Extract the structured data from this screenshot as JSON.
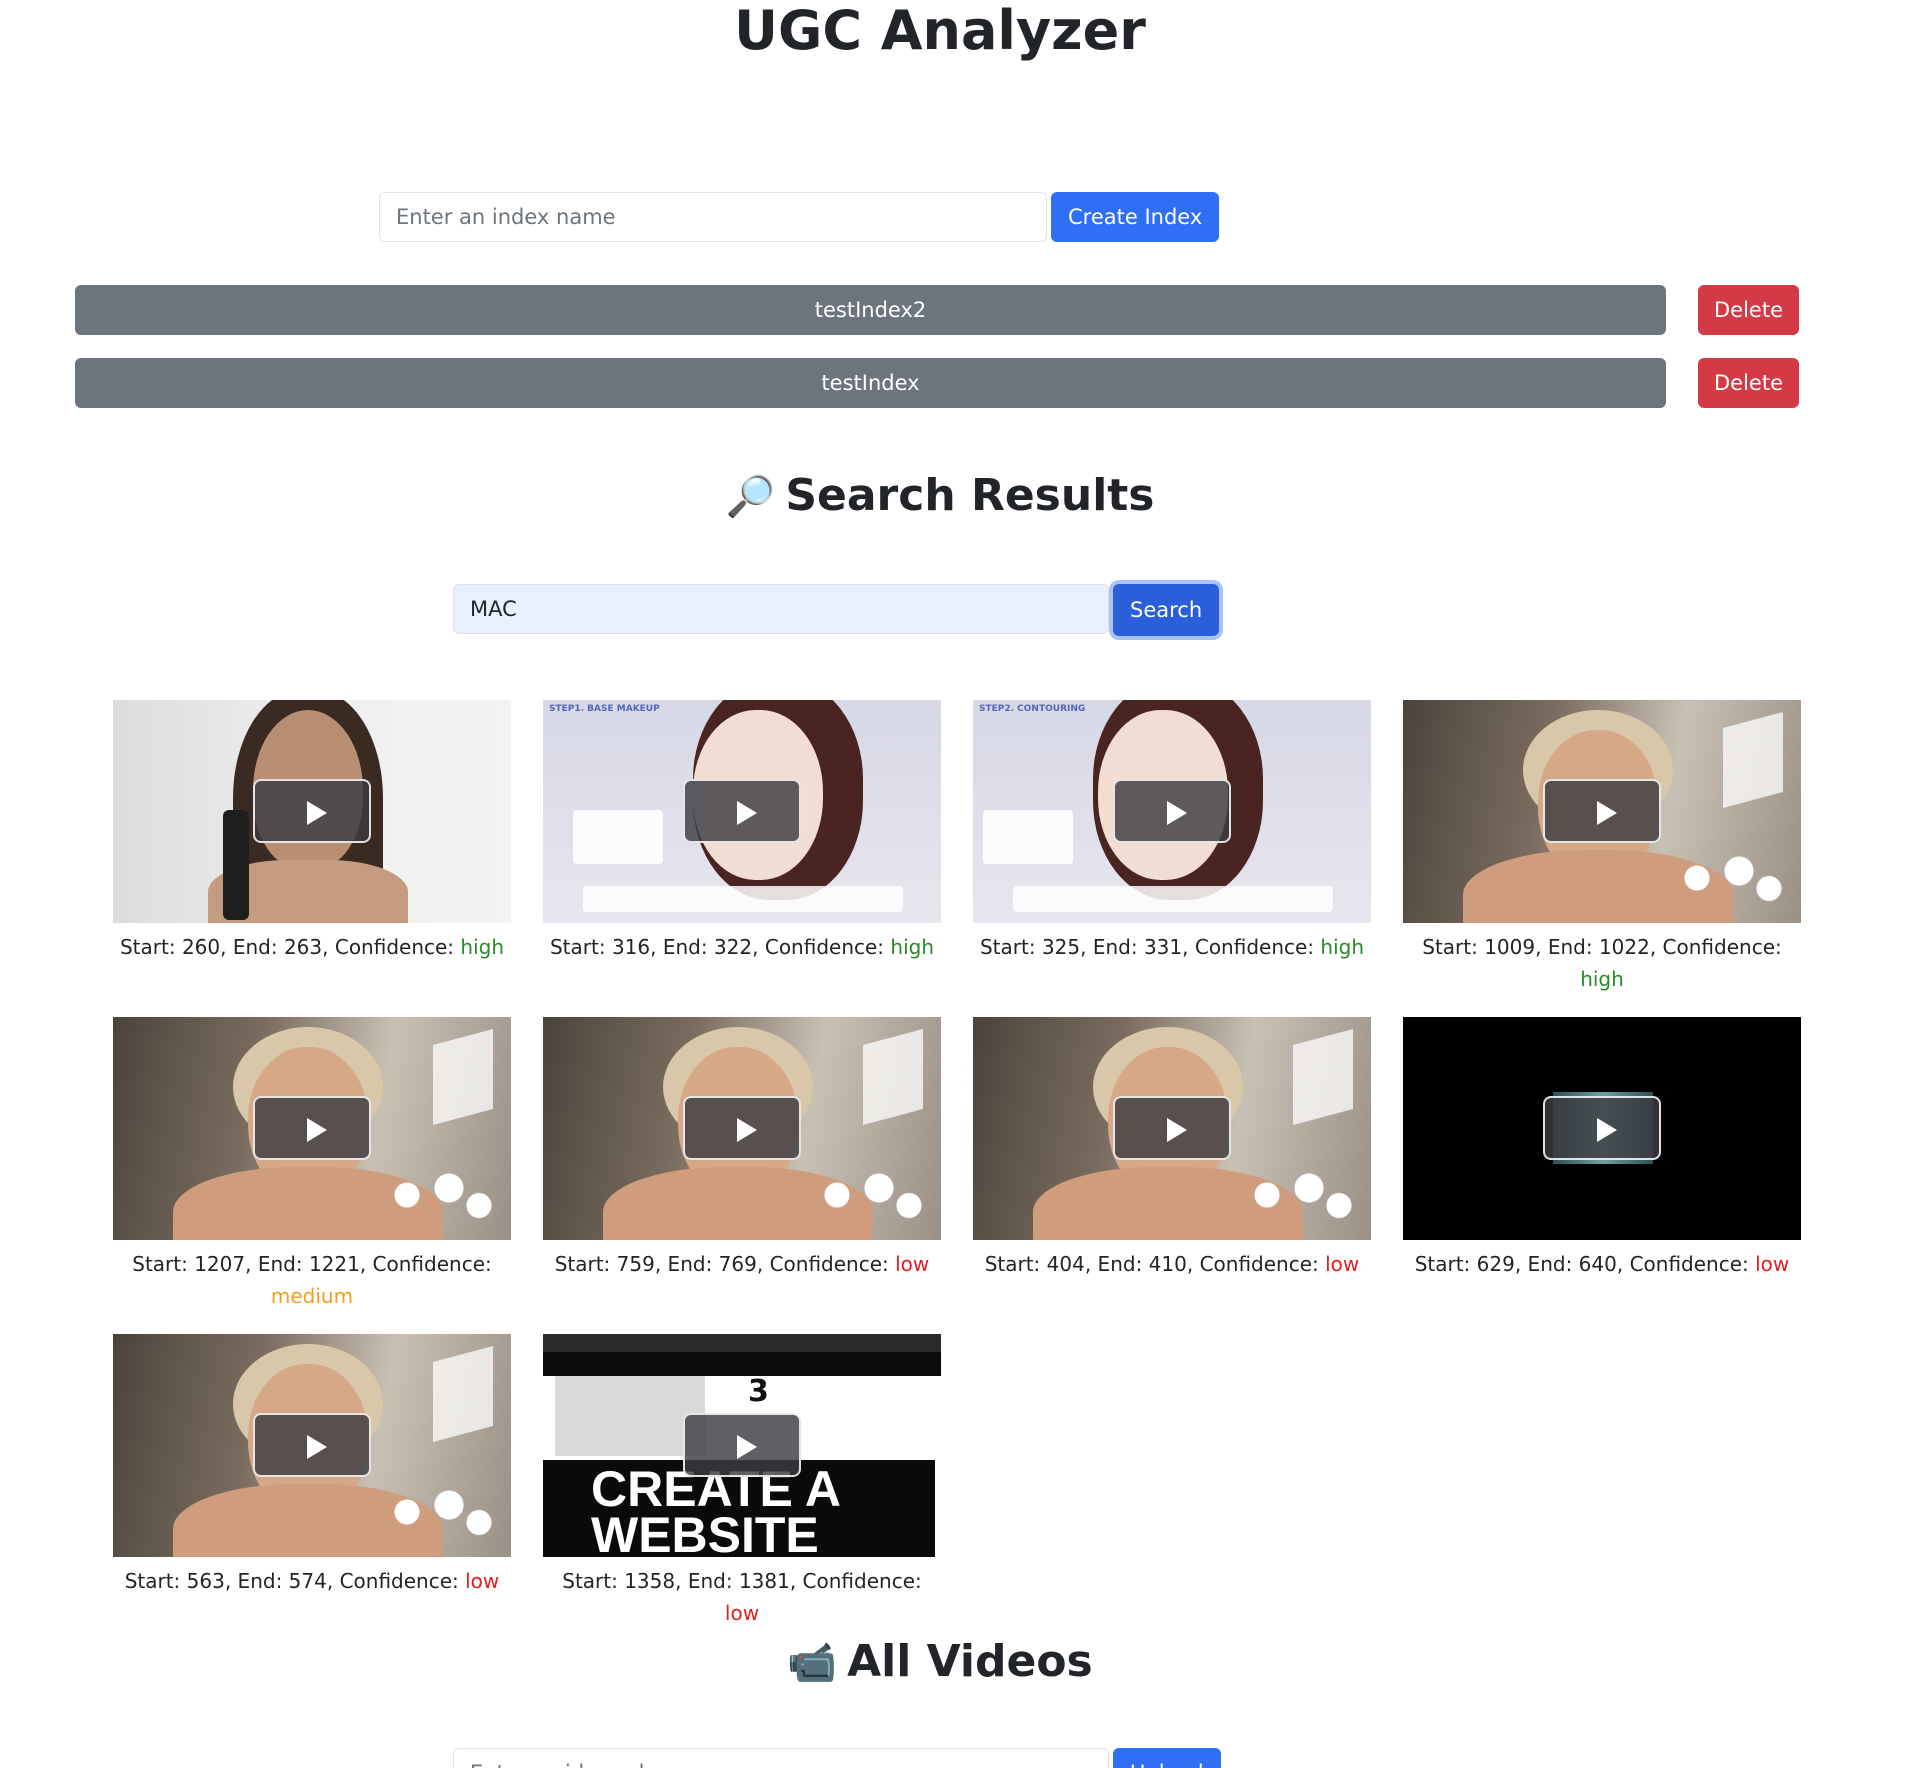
{
  "app": {
    "title": "UGC Analyzer"
  },
  "index_form": {
    "placeholder": "Enter an index name",
    "create_label": "Create Index"
  },
  "indexes": [
    {
      "name": "testIndex2",
      "delete_label": "Delete"
    },
    {
      "name": "testIndex",
      "delete_label": "Delete"
    }
  ],
  "search_section": {
    "icon": "🔎",
    "title": "Search Results",
    "query": "MAC",
    "search_label": "Search"
  },
  "results": [
    {
      "start": "260",
      "end": "263",
      "confidence": "high"
    },
    {
      "start": "316",
      "end": "322",
      "confidence": "high"
    },
    {
      "start": "325",
      "end": "331",
      "confidence": "high"
    },
    {
      "start": "1009",
      "end": "1022",
      "confidence": "high"
    },
    {
      "start": "1207",
      "end": "1221",
      "confidence": "medium"
    },
    {
      "start": "759",
      "end": "769",
      "confidence": "low"
    },
    {
      "start": "404",
      "end": "410",
      "confidence": "low"
    },
    {
      "start": "629",
      "end": "640",
      "confidence": "low"
    },
    {
      "start": "563",
      "end": "574",
      "confidence": "low"
    },
    {
      "start": "1358",
      "end": "1381",
      "confidence": "low"
    }
  ],
  "thumbnails": {
    "k1_label": "STEP1. BASE MAKEUP",
    "k2_label": "STEP2. CONTOURING",
    "web_number": "3",
    "web_banner": "CREATE A WEBSITE"
  },
  "caption_labels": {
    "start": "Start: ",
    "end": ", End: ",
    "confidence": ", Confidence: "
  },
  "videos_section": {
    "icon": "📹",
    "title": "All Videos",
    "placeholder": "Enter a video url",
    "upload_label": "Upload"
  },
  "colors": {
    "primary": "#2f6ff6",
    "secondary": "#6c757d",
    "danger": "#d33a46",
    "high": "#2a8a2a",
    "medium": "#f0a020",
    "low": "#e02020"
  }
}
